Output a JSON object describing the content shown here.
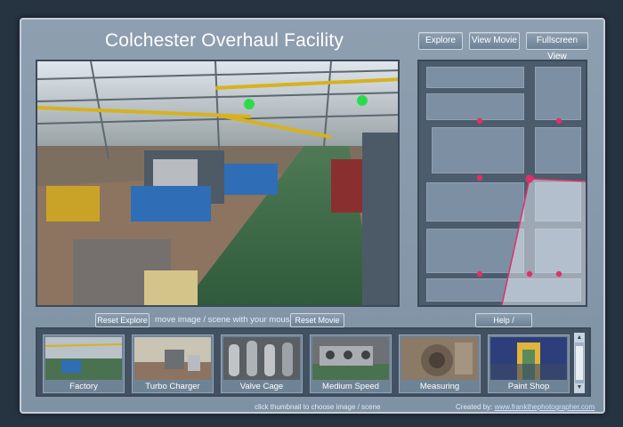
{
  "header": {
    "title": "Colchester Overhaul Facility"
  },
  "toolbar": {
    "explore": "Explore",
    "view_movie": "View Movie",
    "fullscreen": "Fullscreen View"
  },
  "controls": {
    "reset_explore": "Reset Explore",
    "move_hint": "move image / scene with your mouse",
    "reset_movie": "Reset Movie",
    "help": "Help / Instructions"
  },
  "thumbnails": [
    {
      "label": "Factory"
    },
    {
      "label": "Turbo Charger"
    },
    {
      "label": "Valve Cage"
    },
    {
      "label": "Medium Speed"
    },
    {
      "label": "Measuring"
    },
    {
      "label": "Paint Shop"
    }
  ],
  "footer": {
    "hint": "click thumbnail to choose image / scene",
    "credit_prefix": "Created by:",
    "credit_link": "www.frankthephotographer.com"
  },
  "colors": {
    "background": "#263341",
    "frame": "#8a9bad",
    "hotspot": "#e0306a",
    "floor": "#3d6b4a"
  }
}
